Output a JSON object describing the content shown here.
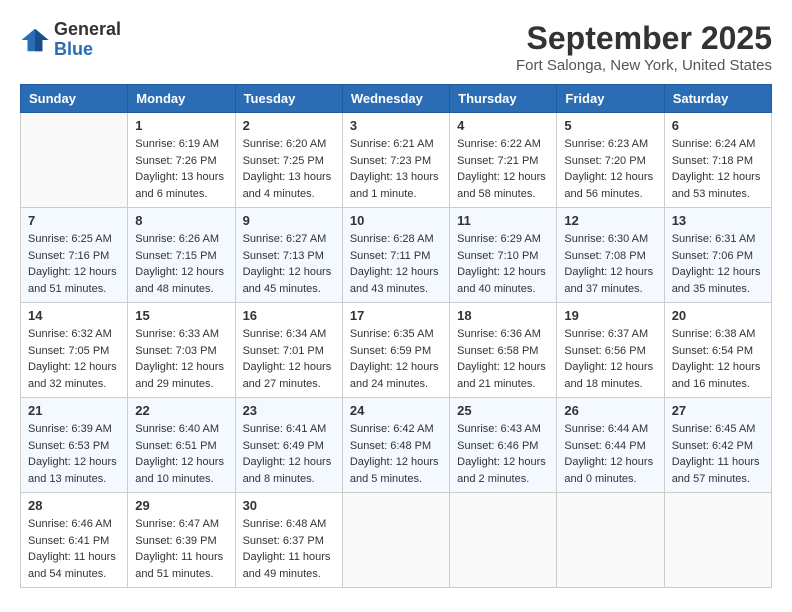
{
  "header": {
    "logo_general": "General",
    "logo_blue": "Blue",
    "month": "September 2025",
    "location": "Fort Salonga, New York, United States"
  },
  "days_of_week": [
    "Sunday",
    "Monday",
    "Tuesday",
    "Wednesday",
    "Thursday",
    "Friday",
    "Saturday"
  ],
  "weeks": [
    [
      {
        "day": "",
        "content": ""
      },
      {
        "day": "1",
        "content": "Sunrise: 6:19 AM\nSunset: 7:26 PM\nDaylight: 13 hours\nand 6 minutes."
      },
      {
        "day": "2",
        "content": "Sunrise: 6:20 AM\nSunset: 7:25 PM\nDaylight: 13 hours\nand 4 minutes."
      },
      {
        "day": "3",
        "content": "Sunrise: 6:21 AM\nSunset: 7:23 PM\nDaylight: 13 hours\nand 1 minute."
      },
      {
        "day": "4",
        "content": "Sunrise: 6:22 AM\nSunset: 7:21 PM\nDaylight: 12 hours\nand 58 minutes."
      },
      {
        "day": "5",
        "content": "Sunrise: 6:23 AM\nSunset: 7:20 PM\nDaylight: 12 hours\nand 56 minutes."
      },
      {
        "day": "6",
        "content": "Sunrise: 6:24 AM\nSunset: 7:18 PM\nDaylight: 12 hours\nand 53 minutes."
      }
    ],
    [
      {
        "day": "7",
        "content": "Sunrise: 6:25 AM\nSunset: 7:16 PM\nDaylight: 12 hours\nand 51 minutes."
      },
      {
        "day": "8",
        "content": "Sunrise: 6:26 AM\nSunset: 7:15 PM\nDaylight: 12 hours\nand 48 minutes."
      },
      {
        "day": "9",
        "content": "Sunrise: 6:27 AM\nSunset: 7:13 PM\nDaylight: 12 hours\nand 45 minutes."
      },
      {
        "day": "10",
        "content": "Sunrise: 6:28 AM\nSunset: 7:11 PM\nDaylight: 12 hours\nand 43 minutes."
      },
      {
        "day": "11",
        "content": "Sunrise: 6:29 AM\nSunset: 7:10 PM\nDaylight: 12 hours\nand 40 minutes."
      },
      {
        "day": "12",
        "content": "Sunrise: 6:30 AM\nSunset: 7:08 PM\nDaylight: 12 hours\nand 37 minutes."
      },
      {
        "day": "13",
        "content": "Sunrise: 6:31 AM\nSunset: 7:06 PM\nDaylight: 12 hours\nand 35 minutes."
      }
    ],
    [
      {
        "day": "14",
        "content": "Sunrise: 6:32 AM\nSunset: 7:05 PM\nDaylight: 12 hours\nand 32 minutes."
      },
      {
        "day": "15",
        "content": "Sunrise: 6:33 AM\nSunset: 7:03 PM\nDaylight: 12 hours\nand 29 minutes."
      },
      {
        "day": "16",
        "content": "Sunrise: 6:34 AM\nSunset: 7:01 PM\nDaylight: 12 hours\nand 27 minutes."
      },
      {
        "day": "17",
        "content": "Sunrise: 6:35 AM\nSunset: 6:59 PM\nDaylight: 12 hours\nand 24 minutes."
      },
      {
        "day": "18",
        "content": "Sunrise: 6:36 AM\nSunset: 6:58 PM\nDaylight: 12 hours\nand 21 minutes."
      },
      {
        "day": "19",
        "content": "Sunrise: 6:37 AM\nSunset: 6:56 PM\nDaylight: 12 hours\nand 18 minutes."
      },
      {
        "day": "20",
        "content": "Sunrise: 6:38 AM\nSunset: 6:54 PM\nDaylight: 12 hours\nand 16 minutes."
      }
    ],
    [
      {
        "day": "21",
        "content": "Sunrise: 6:39 AM\nSunset: 6:53 PM\nDaylight: 12 hours\nand 13 minutes."
      },
      {
        "day": "22",
        "content": "Sunrise: 6:40 AM\nSunset: 6:51 PM\nDaylight: 12 hours\nand 10 minutes."
      },
      {
        "day": "23",
        "content": "Sunrise: 6:41 AM\nSunset: 6:49 PM\nDaylight: 12 hours\nand 8 minutes."
      },
      {
        "day": "24",
        "content": "Sunrise: 6:42 AM\nSunset: 6:48 PM\nDaylight: 12 hours\nand 5 minutes."
      },
      {
        "day": "25",
        "content": "Sunrise: 6:43 AM\nSunset: 6:46 PM\nDaylight: 12 hours\nand 2 minutes."
      },
      {
        "day": "26",
        "content": "Sunrise: 6:44 AM\nSunset: 6:44 PM\nDaylight: 12 hours\nand 0 minutes."
      },
      {
        "day": "27",
        "content": "Sunrise: 6:45 AM\nSunset: 6:42 PM\nDaylight: 11 hours\nand 57 minutes."
      }
    ],
    [
      {
        "day": "28",
        "content": "Sunrise: 6:46 AM\nSunset: 6:41 PM\nDaylight: 11 hours\nand 54 minutes."
      },
      {
        "day": "29",
        "content": "Sunrise: 6:47 AM\nSunset: 6:39 PM\nDaylight: 11 hours\nand 51 minutes."
      },
      {
        "day": "30",
        "content": "Sunrise: 6:48 AM\nSunset: 6:37 PM\nDaylight: 11 hours\nand 49 minutes."
      },
      {
        "day": "",
        "content": ""
      },
      {
        "day": "",
        "content": ""
      },
      {
        "day": "",
        "content": ""
      },
      {
        "day": "",
        "content": ""
      }
    ]
  ]
}
